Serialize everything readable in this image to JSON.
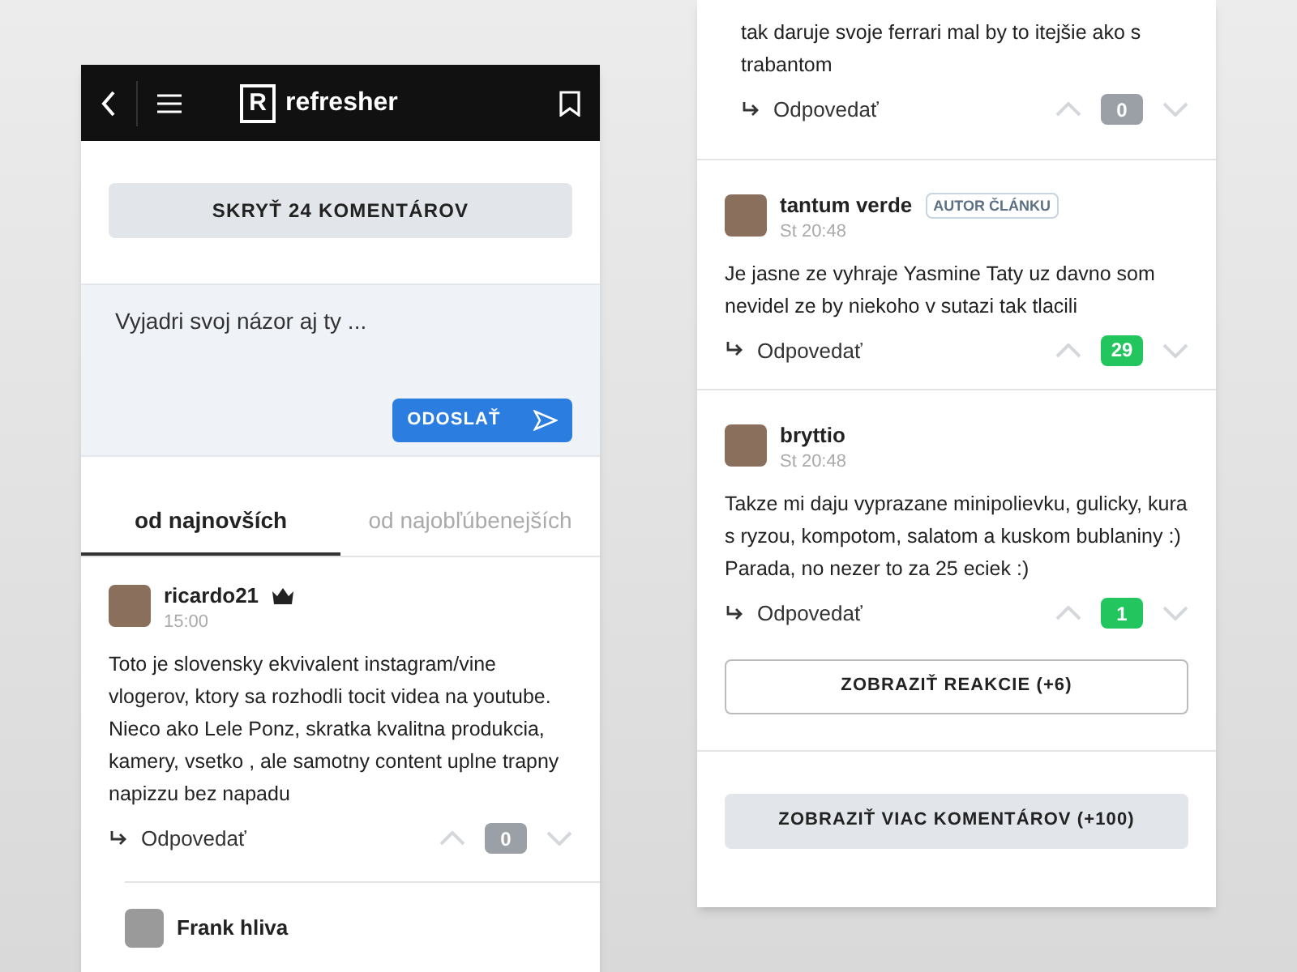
{
  "header": {
    "logo_mark": "R",
    "logo_text": "refresher"
  },
  "hide_button": "SKRYŤ 24 KOMENTÁROV",
  "composer": {
    "placeholder": "Vyjadri svoj názor aj ty ...",
    "send_button": "ODOSLAŤ"
  },
  "tabs": [
    {
      "label": "od najnovších",
      "selected": true
    },
    {
      "label": "od najobľúbenejších",
      "selected": false
    }
  ],
  "left_comments": [
    {
      "author": "ricardo21",
      "crown": true,
      "time": "15:00",
      "text": "Toto je slovensky ekvivalent instagram/vine vlogerov, ktory sa rozhodli tocit videa na youtube. Nieco ako Lele Ponz, skratka kvalitna produkcia, kamery, vsetko , ale samotny content uplne trapny napizzu bez napadu",
      "reply_label": "Odpovedať",
      "score": "0",
      "color": "#9aa0a6"
    }
  ],
  "reply_preview": {
    "author": "Frank hliva"
  },
  "partial_comment": {
    "text": "tak daruje svoje ferrari mal by to itejšie ako s trabantom",
    "reply_label": "Odpovedať",
    "score": "0",
    "color": "#9aa0a6"
  },
  "right_comments": [
    {
      "author": "tantum verde",
      "crown": false,
      "badge": "AUTOR ČLÁNKU",
      "time": "St 20:48",
      "text": "Je jasne ze vyhraje Yasmine Taty uz davno som nevidel ze by niekoho v sutazi tak tlacili",
      "reply_label": "Odpovedať",
      "score": "29",
      "color": "#22c55e"
    },
    {
      "author": "bryttio",
      "crown": false,
      "time": "St 20:48",
      "text": "Takze mi daju vyprazane minipolievku, gulicky, kura s ryzou, kompotom, salatom a kuskom bublaniny :) Parada, no nezer to za 25 eciek :)",
      "reply_label": "Odpovedať",
      "score": "1",
      "color": "#22c55e"
    }
  ],
  "show_reactions_button": "ZOBRAZIŤ REAKCIE (+6)",
  "more_button": "ZOBRAZIŤ VIAC KOMENTÁROV (+100)"
}
